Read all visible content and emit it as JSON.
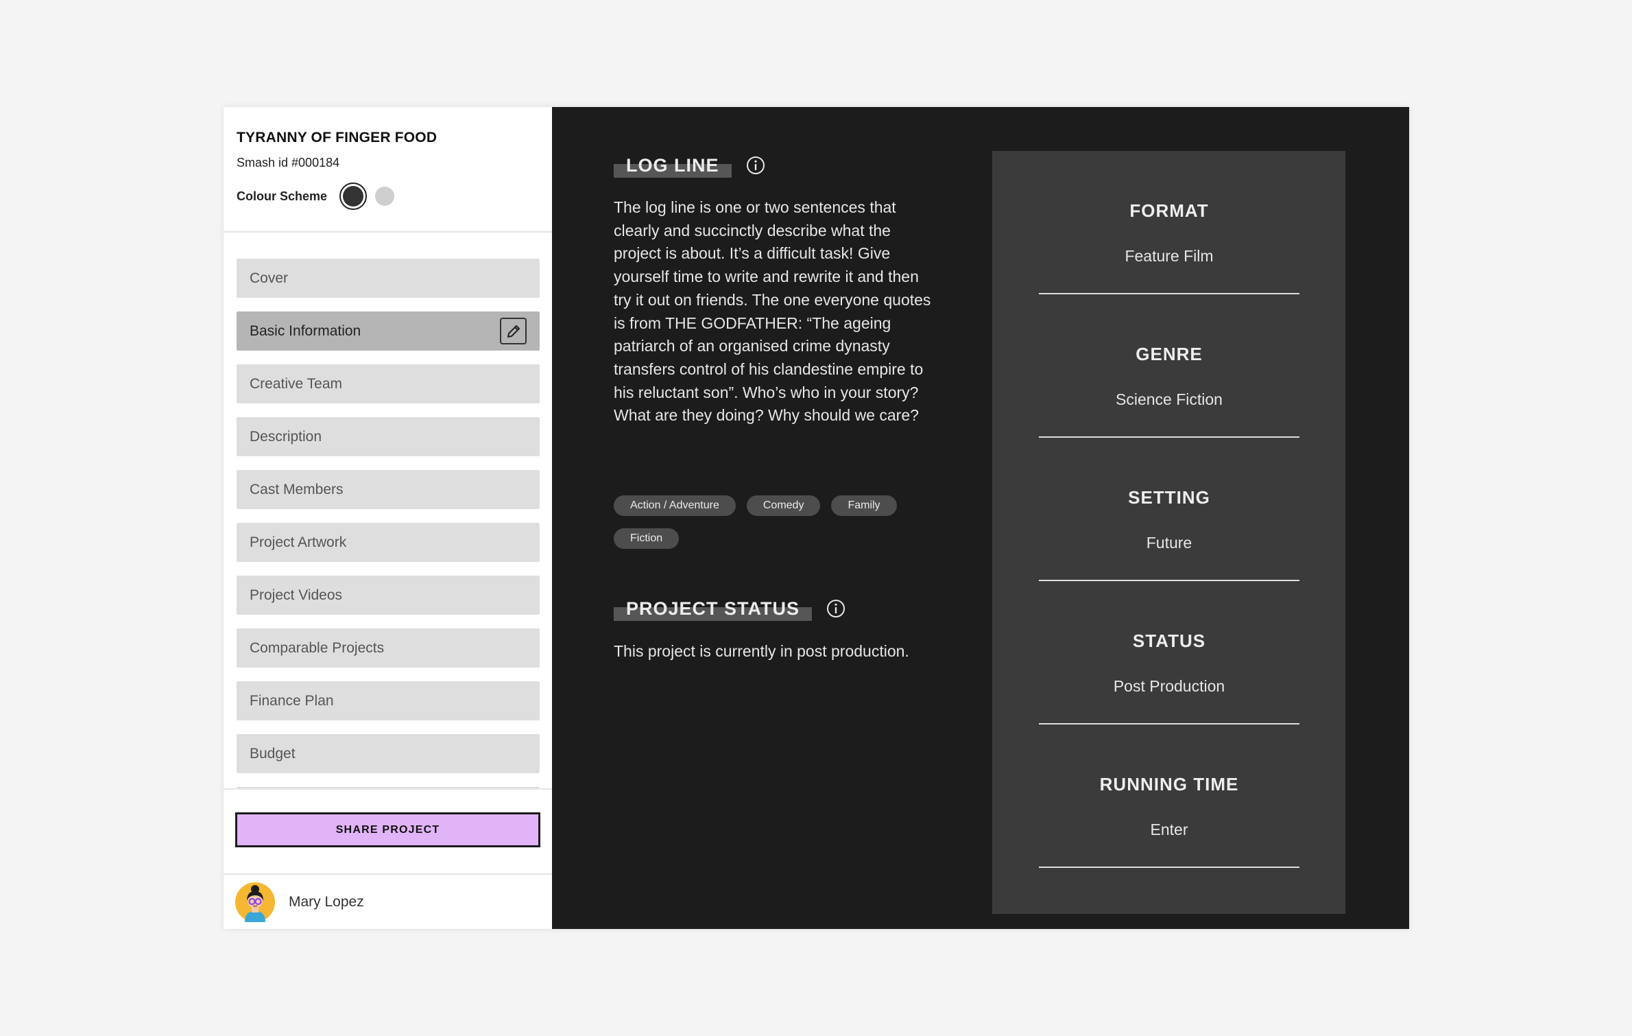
{
  "project": {
    "title": "TYRANNY OF FINGER FOOD",
    "smash_id": "Smash id #000184",
    "colour_scheme_label": "Colour Scheme"
  },
  "colors": {
    "sidebar_bg": "#ffffff",
    "main_bg": "#1c1c1c",
    "panel_bg": "#3b3b3b",
    "share_button": "#e0b4f6",
    "swatch_dark": "#333333",
    "swatch_light": "#cfcfcf"
  },
  "nav": {
    "items": [
      {
        "label": "Cover"
      },
      {
        "label": "Basic Information",
        "active": true,
        "icon": "pencil-icon"
      },
      {
        "label": "Creative Team"
      },
      {
        "label": "Description"
      },
      {
        "label": "Cast Members"
      },
      {
        "label": "Project Artwork"
      },
      {
        "label": "Project Videos"
      },
      {
        "label": "Comparable Projects"
      },
      {
        "label": "Finance Plan"
      },
      {
        "label": "Budget"
      }
    ]
  },
  "share": {
    "label": "SHARE PROJECT"
  },
  "user": {
    "name": "Mary Lopez",
    "avatar": "avatar-icon"
  },
  "log_line": {
    "title": "LOG LINE",
    "text": "The log line is one or two sentences that clearly and succinctly describe what the project is about. It’s a difficult task! Give yourself time to write and rewrite it and then try it out on friends. The one everyone quotes is from THE GODFATHER: “The ageing patriarch of an organised crime dynasty transfers control of his clandestine empire to his reluctant son”. Who’s who in your story? What are they doing? Why should we care?",
    "tags": [
      "Action / Adventure",
      "Comedy",
      "Family",
      "Fiction"
    ]
  },
  "project_status": {
    "title": "PROJECT STATUS",
    "text": "This project is currently in post production."
  },
  "details": [
    {
      "label": "FORMAT",
      "value": "Feature Film"
    },
    {
      "label": "GENRE",
      "value": "Science Fiction"
    },
    {
      "label": "SETTING",
      "value": "Future"
    },
    {
      "label": "STATUS",
      "value": "Post Production"
    },
    {
      "label": "RUNNING TIME",
      "value": "Enter"
    }
  ]
}
